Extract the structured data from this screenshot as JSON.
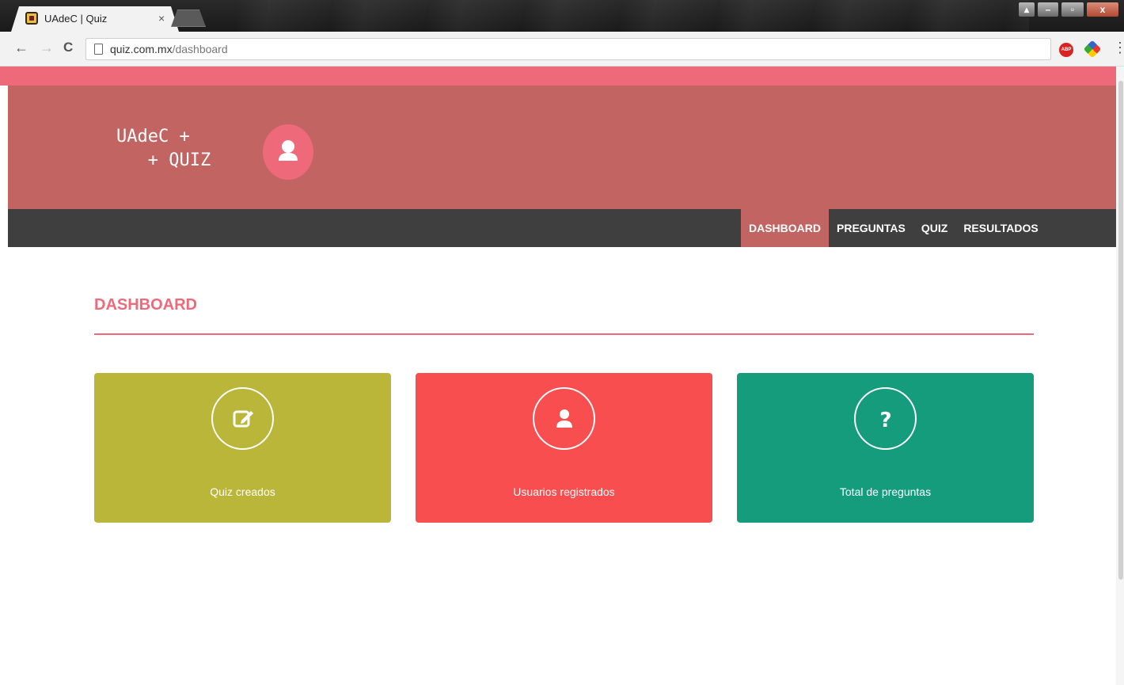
{
  "browser": {
    "tab_title": "UAdeC | Quiz",
    "tab_close": "×",
    "url_host": "quiz.com.mx",
    "url_path": "/dashboard",
    "back": "←",
    "forward": "→",
    "reload": "C",
    "menu": "⋮",
    "ext_abp": "ABP"
  },
  "header": {
    "logo_text": "UAdeC +\n   + QUIZ",
    "avatar_icon": "user-icon"
  },
  "nav": {
    "items": [
      {
        "label": "DASHBOARD",
        "active": true
      },
      {
        "label": "PREGUNTAS",
        "active": false
      },
      {
        "label": "QUIZ",
        "active": false
      },
      {
        "label": "RESULTADOS",
        "active": false
      }
    ]
  },
  "main": {
    "title": "DASHBOARD",
    "cards": [
      {
        "label": "Quiz creados",
        "icon": "edit-icon",
        "color": "#b9b63a"
      },
      {
        "label": "Usuarios registrados",
        "icon": "user-icon",
        "color": "#f84e4f"
      },
      {
        "label": "Total de preguntas",
        "icon": "question-icon",
        "color": "#149c7d"
      }
    ]
  },
  "colors": {
    "accent": "#ee6a7b",
    "banner": "#c16462",
    "navbar": "#3f3f3f"
  }
}
